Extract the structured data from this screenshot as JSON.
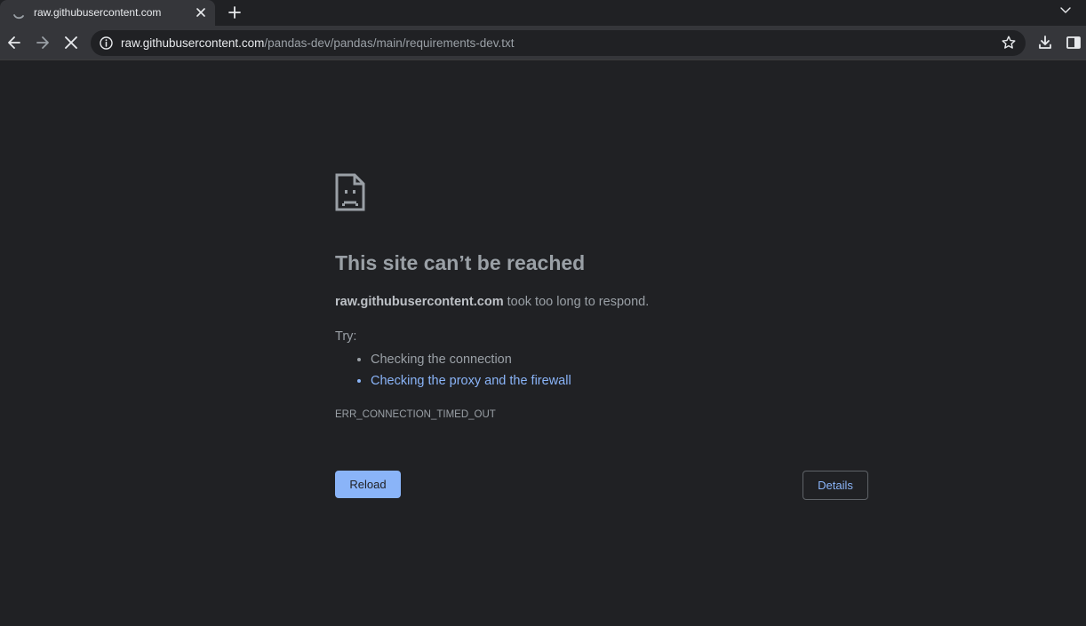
{
  "tab": {
    "title": "raw.githubusercontent.com",
    "spinner_icon": "loading-spinner-icon",
    "close_icon": "close-icon"
  },
  "tabstrip": {
    "new_tab_icon": "plus-icon",
    "tab_search_icon": "chevron-down-icon"
  },
  "toolbar": {
    "back_icon": "arrow-left-icon",
    "forward_icon": "arrow-right-icon",
    "stop_icon": "close-icon",
    "info_icon": "info-icon",
    "bookmark_icon": "star-icon",
    "download_icon": "download-icon",
    "side_panel_icon": "side-panel-icon"
  },
  "omnibox": {
    "host": "raw.githubusercontent.com",
    "path": "/pandas-dev/pandas/main/requirements-dev.txt"
  },
  "error": {
    "icon": "sad-page-icon",
    "title": "This site can’t be reached",
    "host": "raw.githubusercontent.com",
    "message": " took too long to respond.",
    "try_label": "Try:",
    "suggestions": [
      "Checking the connection",
      "Checking the proxy and the firewall"
    ],
    "code": "ERR_CONNECTION_TIMED_OUT",
    "reload_label": "Reload",
    "details_label": "Details"
  },
  "colors": {
    "background": "#202124",
    "toolbar": "#35363a",
    "accent_blue": "#8ab4f8",
    "muted_text": "#9aa0a6"
  }
}
